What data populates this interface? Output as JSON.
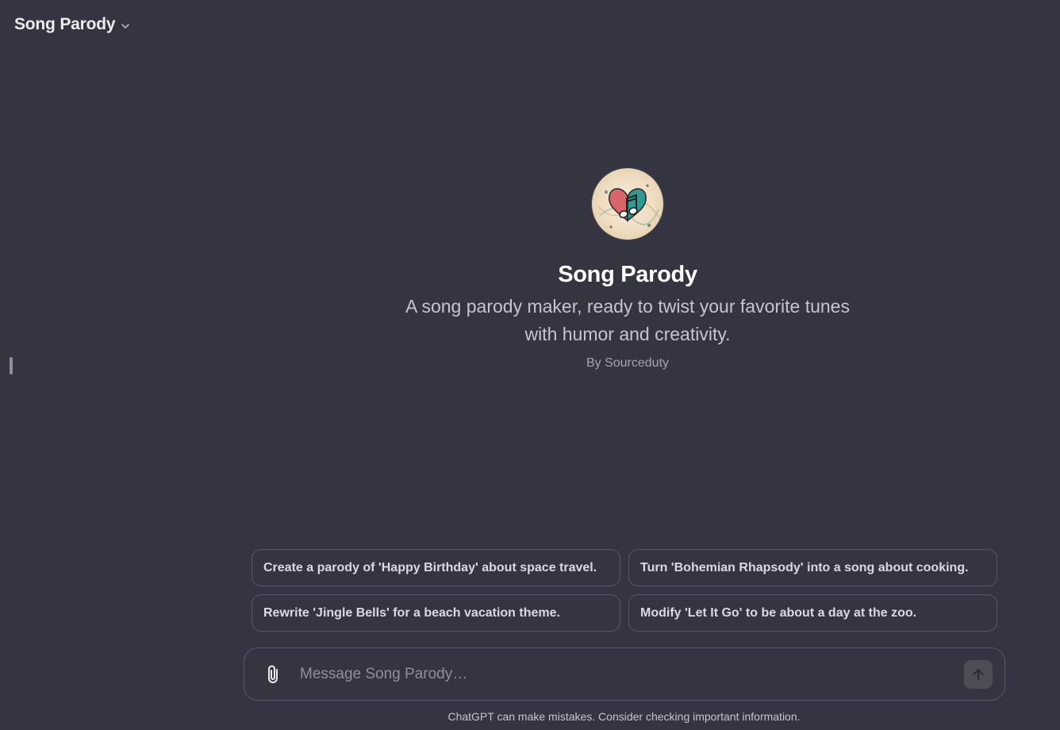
{
  "header": {
    "title": "Song Parody",
    "chevron_icon": "chevron-down-icon"
  },
  "gpt": {
    "name": "Song Parody",
    "description": "A song parody maker, ready to twist your favorite tunes with humor and creativity.",
    "author": "By Sourceduty",
    "avatar_icon": "music-heart-logo"
  },
  "suggestions": [
    "Create a parody of 'Happy Birthday' about space travel.",
    "Turn 'Bohemian Rhapsody' into a song about cooking.",
    "Rewrite 'Jingle Bells' for a beach vacation theme.",
    "Modify 'Let It Go' to be about a day at the zoo."
  ],
  "composer": {
    "placeholder": "Message Song Parody…",
    "attach_icon": "paperclip-icon",
    "send_icon": "arrow-up-icon"
  },
  "disclaimer": "ChatGPT can make mistakes. Consider checking important information.",
  "colors": {
    "background": "#343541",
    "border": "#565869",
    "text": "#ececf1"
  }
}
